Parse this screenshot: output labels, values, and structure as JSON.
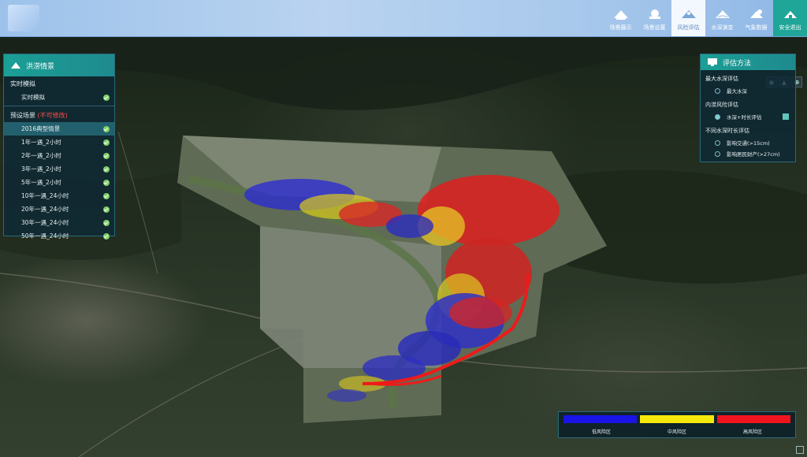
{
  "header": {
    "brand": "",
    "nav": [
      {
        "label": "场景展示"
      },
      {
        "label": "场景设置"
      },
      {
        "label": "风险评估"
      },
      {
        "label": "水深演变"
      },
      {
        "label": "气象数据"
      },
      {
        "label": "安全退出"
      }
    ]
  },
  "left_panel": {
    "title": "洪涝情景",
    "realtime_section": "实时模拟",
    "realtime_item": "实时模拟",
    "preset_section": "预设场景",
    "preset_warning": "(不可修改)",
    "scenarios": [
      "2016典型情景",
      "1年一遇_2小时",
      "2年一遇_2小时",
      "3年一遇_2小时",
      "5年一遇_2小时",
      "10年一遇_24小时",
      "20年一遇_24小时",
      "30年一遇_24小时",
      "50年一遇_24小时"
    ]
  },
  "right_panel": {
    "title": "评估方法",
    "section1": "最大水深评估",
    "opt1": "最大水深",
    "section2": "内涝风险评估",
    "opt2": "水深+时长评估",
    "section3": "不同水深时长评估",
    "opt3": "影响交通(>15cm)",
    "opt4": "影响居民财产(>27cm)"
  },
  "legend": {
    "items": [
      {
        "label": "低风险区",
        "color": "#1a14e6"
      },
      {
        "label": "中风险区",
        "color": "#f5e90c"
      },
      {
        "label": "高风险区",
        "color": "#f0141e"
      }
    ]
  },
  "colors": {
    "accent": "#1fa698",
    "risk_low": "#1a14e6",
    "risk_mid": "#f5e90c",
    "risk_high": "#f0141e"
  }
}
